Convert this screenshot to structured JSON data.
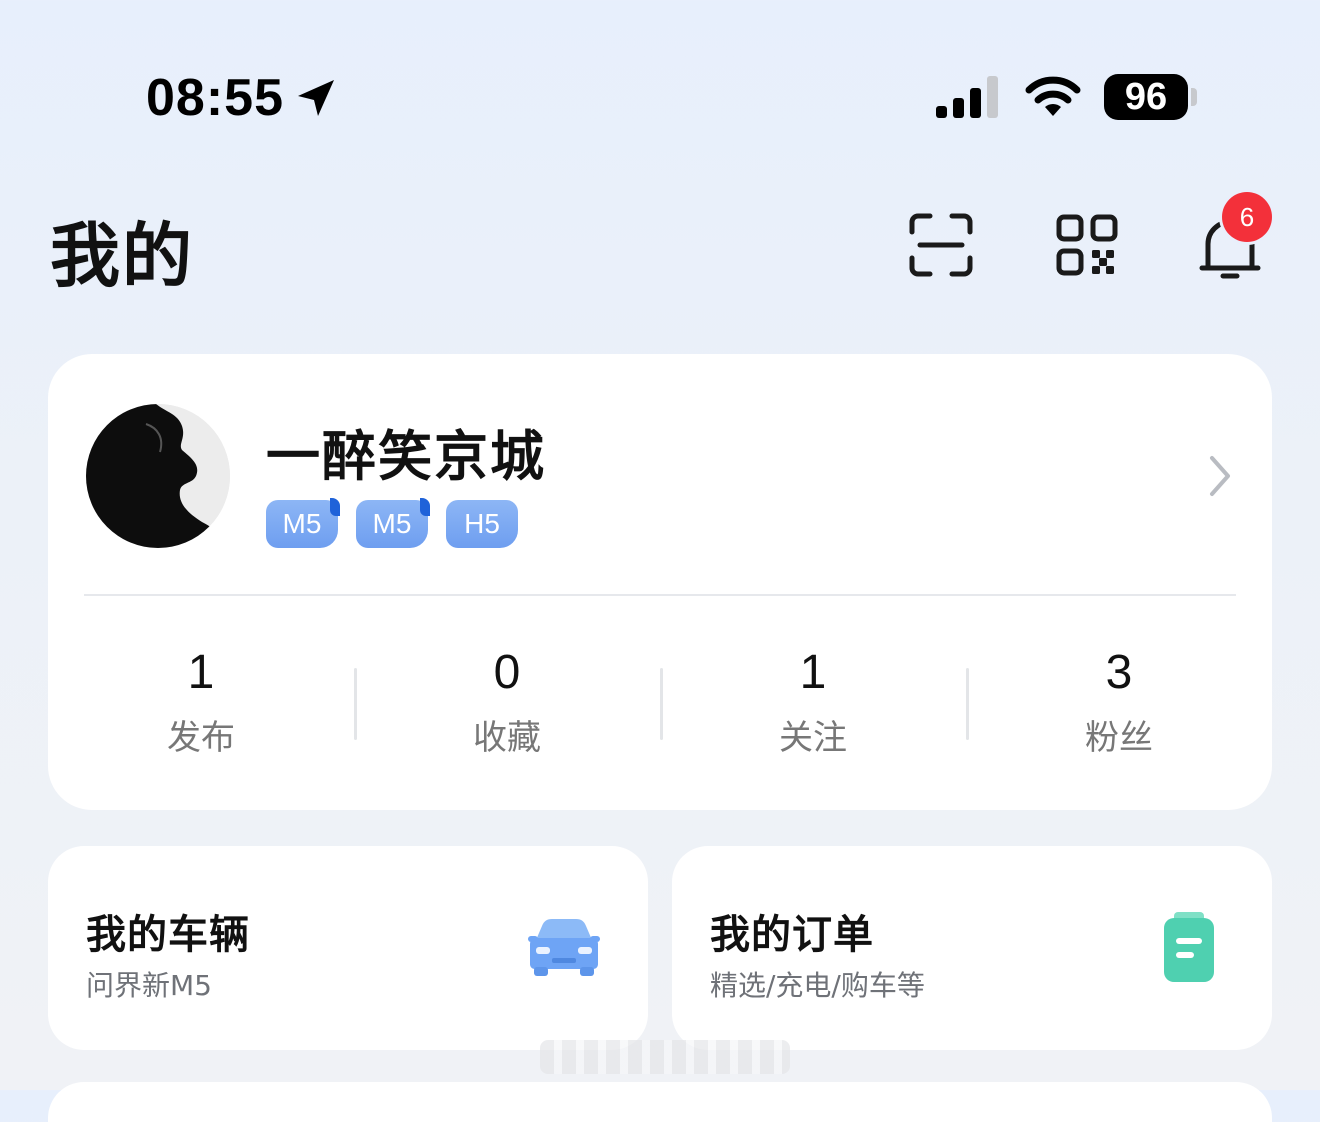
{
  "status_bar": {
    "time": "08:55",
    "battery": "96",
    "icons": [
      "location-arrow-icon",
      "cellular-signal-icon",
      "wifi-icon",
      "battery-icon"
    ]
  },
  "header": {
    "title": "我的",
    "icons": [
      "scan-icon",
      "qr-code-icon",
      "bell-icon"
    ],
    "notification_count": "6",
    "badge_color": "#f3303a"
  },
  "profile": {
    "name": "一醉笑京城",
    "vehicle_tags": [
      "M5",
      "M5",
      "H5"
    ],
    "tag_color": "#7aa8f2",
    "stats": [
      {
        "value": "1",
        "label": "发布"
      },
      {
        "value": "0",
        "label": "收藏"
      },
      {
        "value": "1",
        "label": "关注"
      },
      {
        "value": "3",
        "label": "粉丝"
      }
    ]
  },
  "quick_cards": [
    {
      "title": "我的车辆",
      "subtitle": "问界新M5",
      "icon": "car-icon",
      "icon_color": "#6ea4f5"
    },
    {
      "title": "我的订单",
      "subtitle": "精选/充电/购车等",
      "icon": "order-clipboard-icon",
      "icon_color": "#4fd0b0"
    }
  ]
}
